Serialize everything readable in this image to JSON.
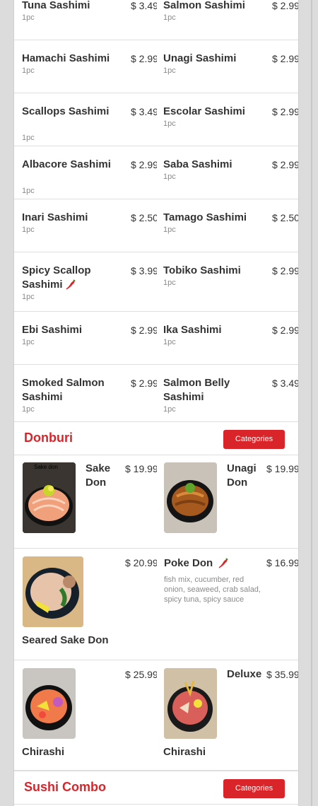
{
  "sashimi_rows": [
    [
      {
        "name": "Tuna Sashimi",
        "price": "$ 3.49",
        "qty": "1pc",
        "spicy": false
      },
      {
        "name": "Salmon Sashimi",
        "price": "$ 2.99",
        "qty": "1pc",
        "spicy": false
      }
    ],
    [
      {
        "name": "Hamachi Sashimi",
        "price": "$ 2.99",
        "qty": "1pc",
        "spicy": false
      },
      {
        "name": "Unagi Sashimi",
        "price": "$ 2.99",
        "qty": "1pc",
        "spicy": false
      }
    ],
    [
      {
        "name": "Scallops Sashimi",
        "price": "$ 3.49",
        "qty": "1pc",
        "spicy": false
      },
      {
        "name": "Escolar Sashimi",
        "price": "$ 2.99",
        "qty": "1pc",
        "spicy": false
      }
    ],
    [
      {
        "name": "Albacore Sashimi",
        "price": "$ 2.99",
        "qty": "1pc",
        "spicy": false
      },
      {
        "name": "Saba Sashimi",
        "price": "$ 2.99",
        "qty": "1pc",
        "spicy": false
      }
    ],
    [
      {
        "name": "Inari Sashimi",
        "price": "$ 2.50",
        "qty": "1pc",
        "spicy": false
      },
      {
        "name": "Tamago Sashimi",
        "price": "$ 2.50",
        "qty": "1pc",
        "spicy": false
      }
    ],
    [
      {
        "name": "Spicy Scallop Sashimi",
        "price": "$ 3.99",
        "qty": "1pc",
        "spicy": true
      },
      {
        "name": "Tobiko Sashimi",
        "price": "$ 2.99",
        "qty": "1pc",
        "spicy": false
      }
    ],
    [
      {
        "name": "Ebi Sashimi",
        "price": "$ 2.99",
        "qty": "1pc",
        "spicy": false
      },
      {
        "name": "Ika Sashimi",
        "price": "$ 2.99",
        "qty": "1pc",
        "spicy": false
      }
    ],
    [
      {
        "name": "Smoked Salmon Sashimi",
        "price": "$ 2.99",
        "qty": "1pc",
        "spicy": false
      },
      {
        "name": "Salmon Belly Sashimi",
        "price": "$ 3.49",
        "qty": "1pc",
        "spicy": false
      }
    ]
  ],
  "donburi": {
    "title": "Donburi",
    "button": "Categories",
    "rows": [
      [
        {
          "name": "Sake Don",
          "price": "$ 19.99",
          "photo_label": "Sake don",
          "desc": "",
          "spicy": false
        },
        {
          "name": "Unagi Don",
          "price": "$ 19.99",
          "photo_label": "",
          "desc": "",
          "spicy": false
        }
      ],
      [
        {
          "name": "Seared Sake Don",
          "price": "$ 20.99",
          "photo_label": "",
          "desc": "",
          "spicy": false
        },
        {
          "name": "Poke Don",
          "price": "$ 16.99",
          "photo_label": "",
          "desc": "fish mix, cucumber, red onion, seaweed, crab salad, spicy tuna, spicy sauce",
          "spicy": true
        }
      ],
      [
        {
          "name": "Chirashi",
          "price": "$ 25.99",
          "photo_label": "",
          "desc": "",
          "spicy": false
        },
        {
          "name": "Deluxe Chirashi",
          "price": "$ 35.99",
          "photo_label": "",
          "desc": "",
          "spicy": false
        }
      ]
    ]
  },
  "sushi_combo": {
    "title": "Sushi Combo",
    "button": "Categories"
  },
  "colors": {
    "accent": "#d9252a",
    "background": "#dcdcdc"
  }
}
